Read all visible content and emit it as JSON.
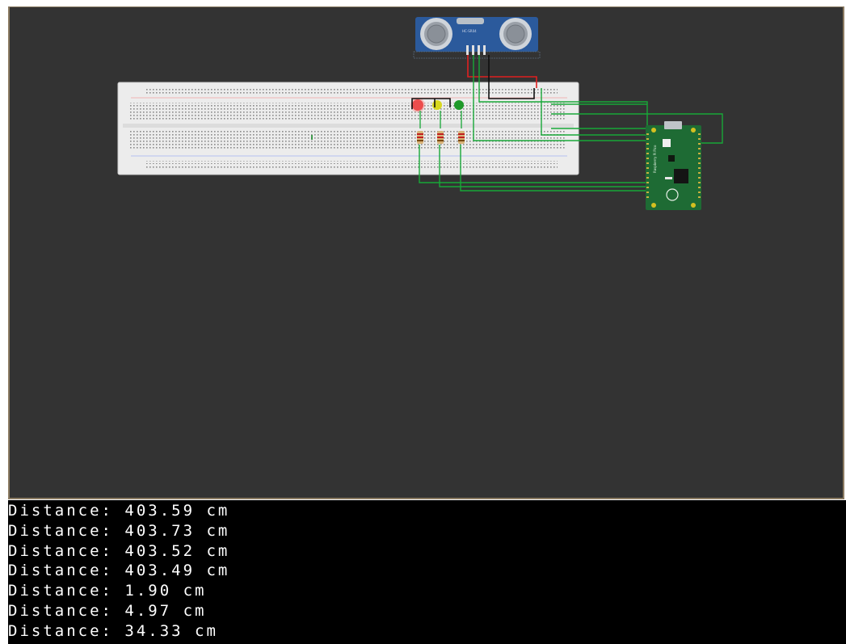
{
  "simulator": {
    "components": {
      "ultrasonic_sensor": {
        "label": "HC-SR04"
      },
      "breadboard": {
        "name": "breadboard"
      },
      "leds": [
        {
          "name": "red-led",
          "color": "#e23b3b"
        },
        {
          "name": "yellow-led",
          "color": "#d8d81e"
        },
        {
          "name": "green-led",
          "color": "#1f9a2a"
        }
      ],
      "microcontroller": {
        "label": "Raspberry Pi Pico"
      }
    },
    "colors": {
      "canvas_bg": "#333333",
      "frame": "#8c7c63",
      "wire_green": "#18a838",
      "wire_red": "#e02020",
      "wire_black": "#101010",
      "board_green": "#1e6b34",
      "sensor_blue": "#2b5a9c"
    }
  },
  "console": {
    "lines": [
      "Distance: 403.59 cm",
      "Distance: 403.73 cm",
      "Distance: 403.52 cm",
      "Distance: 403.49 cm",
      "Distance: 1.90 cm",
      "Distance: 4.97 cm",
      "Distance: 34.33 cm"
    ]
  }
}
